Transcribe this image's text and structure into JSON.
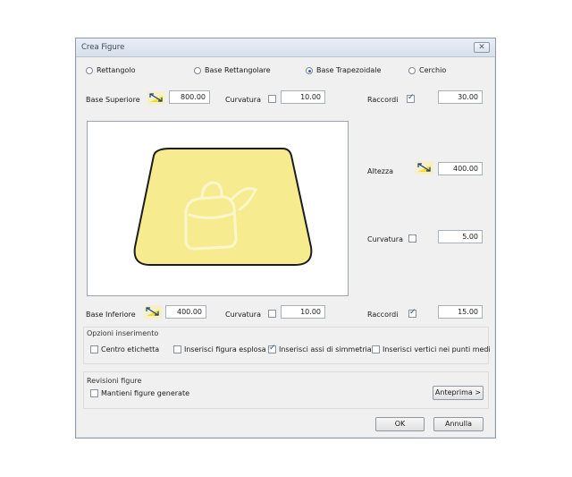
{
  "window": {
    "title": "Crea Figure",
    "close_symbol": "✕"
  },
  "shape_options": {
    "items": [
      {
        "label": "Rettangolo",
        "checked": false
      },
      {
        "label": "Base Rettangolare",
        "checked": false
      },
      {
        "label": "Base Trapezoidale",
        "checked": true
      },
      {
        "label": "Cerchio",
        "checked": false
      }
    ]
  },
  "top_row": {
    "base_label": "Base Superiore",
    "base_value": "800.00",
    "curv_label": "Curvatura",
    "curv_value": "10.00",
    "racc_label": "Raccordi",
    "racc_value": "30.00"
  },
  "right_panel": {
    "height_label": "Altezza",
    "height_value": "400.00",
    "curv_label": "Curvatura",
    "curv_value": "5.00"
  },
  "bottom_row": {
    "base_label": "Base Inferiore",
    "base_value": "400.00",
    "curv_label": "Curvatura",
    "curv_value": "10.00",
    "racc_label": "Raccordi",
    "racc_value": "15.00"
  },
  "insert_options": {
    "title": "Opzioni inserimento",
    "items": [
      {
        "label": "Centro etichetta",
        "checked": false
      },
      {
        "label": "Inserisci figura esplosa",
        "checked": false
      },
      {
        "label": "Inserisci assi di simmetria",
        "checked": true
      },
      {
        "label": "Inserisci vertici nei punti medi",
        "checked": false
      }
    ]
  },
  "revisions": {
    "title": "Revisioni figure",
    "keep_label": "Mantieni figure generate",
    "preview_button": "Anteprima >"
  },
  "footer": {
    "ok": "OK",
    "cancel": "Annulla"
  },
  "colors": {
    "shape_fill": "#f7eb8f",
    "shape_stroke": "#1c1c1c",
    "accent": "#2f66b8"
  },
  "icons": {
    "measure_icon": "measure-arrow-icon",
    "watermark": "bag-watermark-icon"
  }
}
